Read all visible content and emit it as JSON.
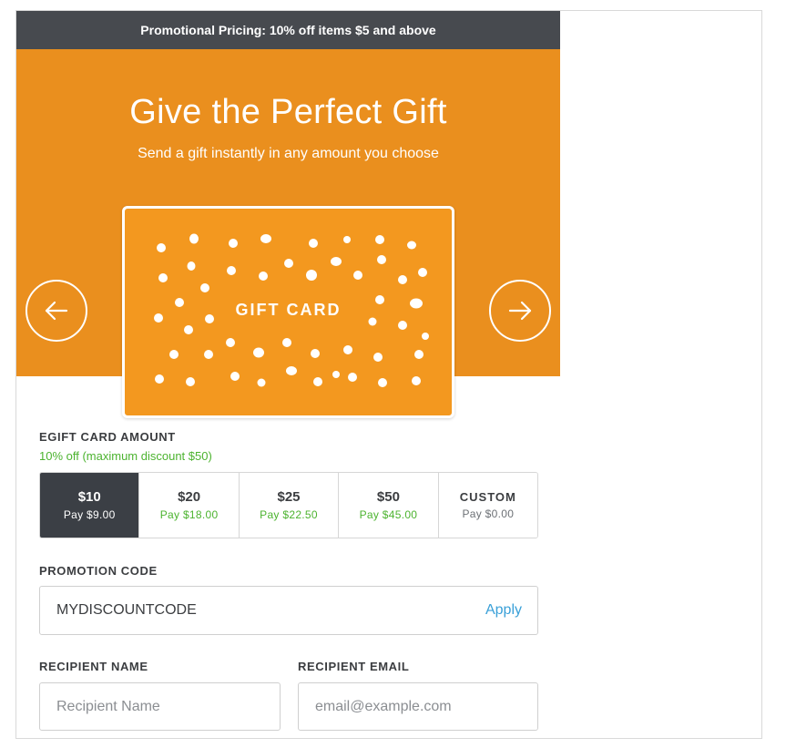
{
  "promo_bar": {
    "text": "Promotional Pricing: 10% off items $5 and above"
  },
  "hero": {
    "title": "Give the Perfect Gift",
    "subtitle": "Send a gift instantly in any amount you choose",
    "card_label": "GIFT CARD",
    "prev_icon": "arrow-left-icon",
    "next_icon": "arrow-right-icon"
  },
  "amount_section": {
    "label": "EGIFT CARD AMOUNT",
    "discount_note": "10% off (maximum discount $50)",
    "options": [
      {
        "amount": "$10",
        "pay": "Pay $9.00",
        "selected": true
      },
      {
        "amount": "$20",
        "pay": "Pay $18.00",
        "selected": false
      },
      {
        "amount": "$25",
        "pay": "Pay $22.50",
        "selected": false
      },
      {
        "amount": "$50",
        "pay": "Pay $45.00",
        "selected": false
      },
      {
        "amount": "CUSTOM",
        "pay": "Pay $0.00",
        "selected": false
      }
    ]
  },
  "promotion": {
    "label": "PROMOTION CODE",
    "value": "MYDISCOUNTCODE",
    "apply_label": "Apply"
  },
  "recipient": {
    "name_label": "RECIPIENT NAME",
    "name_placeholder": "Recipient Name",
    "email_label": "RECIPIENT EMAIL",
    "email_placeholder": "email@example.com"
  },
  "colors": {
    "promo_bar": "#474a4f",
    "hero_orange": "#ea8f1e",
    "card_orange": "#f3981f",
    "selected_dark": "#3b3f45",
    "discount_green": "#4cb32f",
    "link_blue": "#3aa0d8"
  }
}
